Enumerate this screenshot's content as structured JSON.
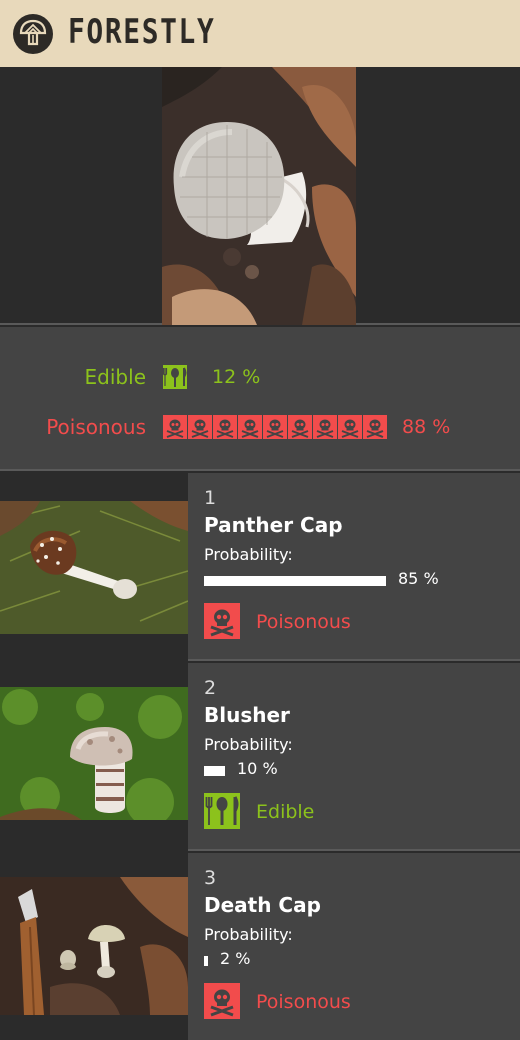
{
  "app": {
    "brand": "FORESTLY",
    "logo_icon": "mushroom-logo-icon",
    "header_bg": "#e8d9bb"
  },
  "hero": {
    "photo": "puffy-white-mushroom-photo"
  },
  "summary": {
    "edible": {
      "label": "Edible",
      "percent": 12,
      "percent_text": "12 %",
      "icon": "fork-spoon-icon",
      "icon_count": 1,
      "color": "#8cc21c"
    },
    "poisonous": {
      "label": "Poisonous",
      "percent": 88,
      "percent_text": "88 %",
      "icon": "skull-icon",
      "icon_count": 9,
      "color": "#f24c4c"
    }
  },
  "results": [
    {
      "rank": "1",
      "name": "Panther Cap",
      "prob_label": "Probability:",
      "probability": 85,
      "prob_text": "85 %",
      "classification": "Poisonous",
      "class_icon": "skull-icon",
      "class_color": "#f24c4c",
      "photo": "panther-cap-photo"
    },
    {
      "rank": "2",
      "name": "Blusher",
      "prob_label": "Probability:",
      "probability": 10,
      "prob_text": "10 %",
      "classification": "Edible",
      "class_icon": "fork-spoon-icon",
      "class_color": "#8cc21c",
      "photo": "blusher-photo"
    },
    {
      "rank": "3",
      "name": "Death Cap",
      "prob_label": "Probability:",
      "probability": 2,
      "prob_text": "2 %",
      "classification": "Poisonous",
      "class_icon": "skull-icon",
      "class_color": "#f24c4c",
      "photo": "death-cap-photo"
    }
  ]
}
